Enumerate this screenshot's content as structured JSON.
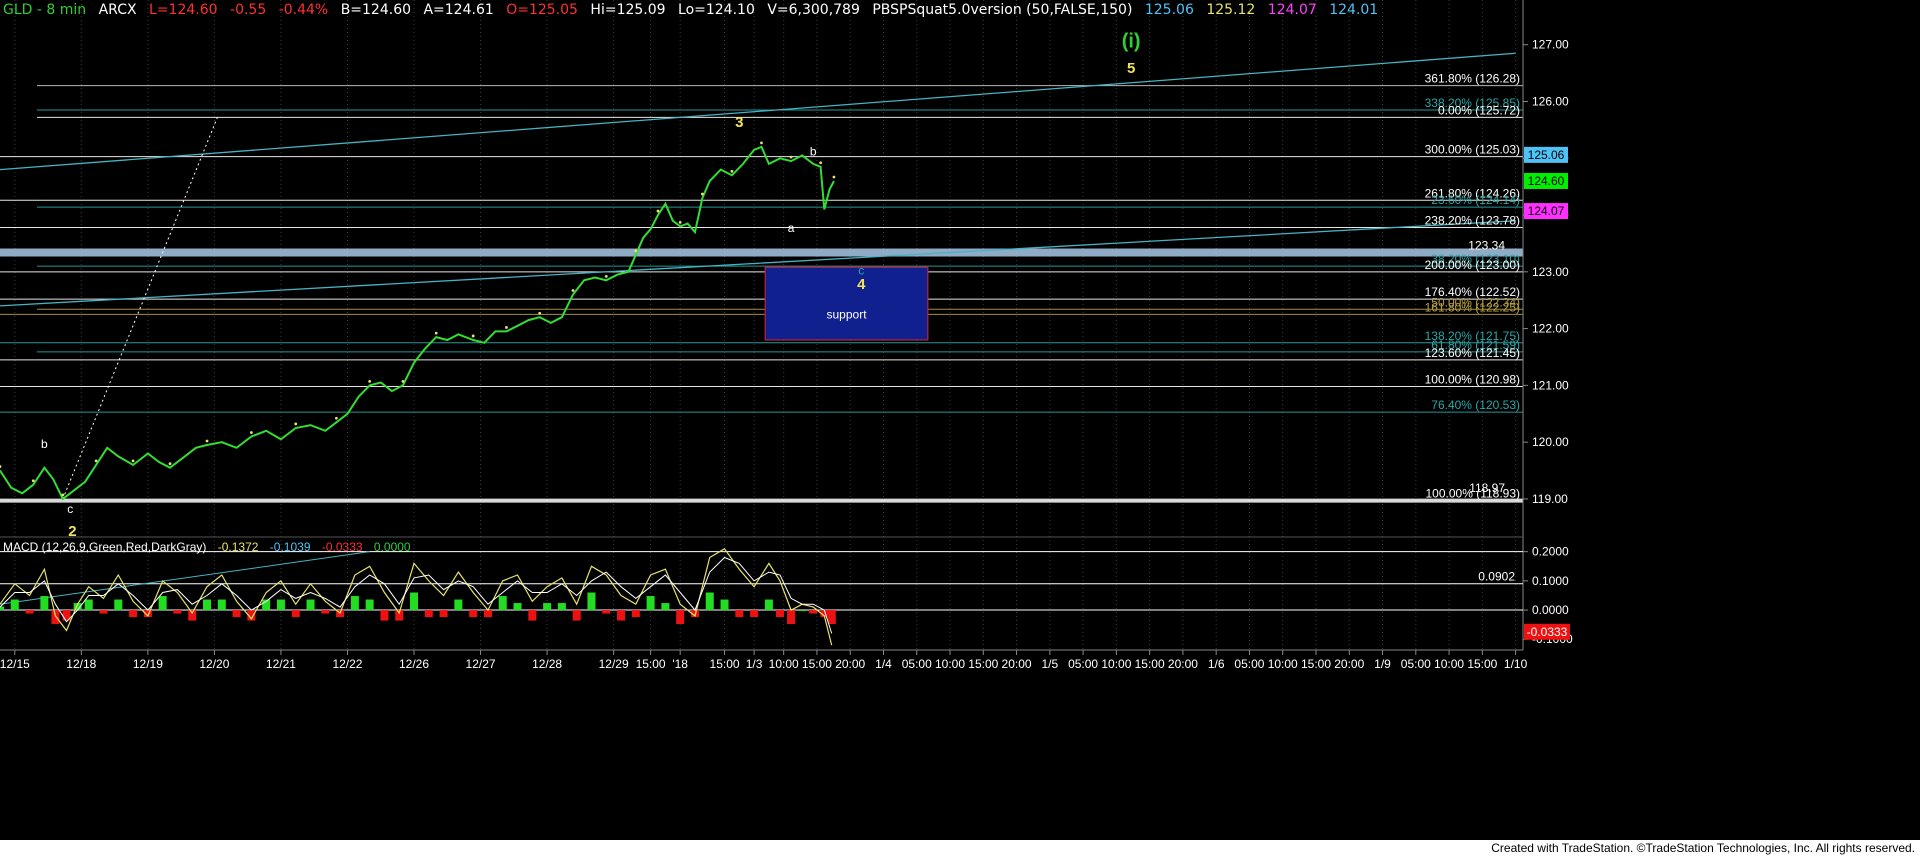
{
  "header": {
    "symbol": "GLD - 8 min",
    "exchange": "ARCX",
    "last": "L=124.60",
    "change": "-0.55",
    "change_pct": "-0.44%",
    "bid": "B=124.60",
    "ask": "A=124.61",
    "open": "O=125.05",
    "high": "Hi=125.09",
    "low": "Lo=124.10",
    "volume": "V=6,300,789",
    "indicator": "PBSPSquat5.0version (50,FALSE,150)",
    "ind_values": [
      {
        "text": "125.06",
        "color": "#4fc3f7"
      },
      {
        "text": "125.12",
        "color": "#e8e26a"
      },
      {
        "text": "124.07",
        "color": "#ff40ff"
      },
      {
        "text": "124.01",
        "color": "#4fc3f7"
      }
    ]
  },
  "macd_header": {
    "name": "MACD (12,26,9,Green,Red,DarkGray)",
    "values": [
      {
        "text": "-0.1372",
        "color": "#e8e26a"
      },
      {
        "text": "-0.1039",
        "color": "#4fc3f7"
      },
      {
        "text": "-0.0333",
        "color": "#ff3030"
      },
      {
        "text": "0.0000",
        "color": "#2ecc40"
      }
    ]
  },
  "footer": "Created with TradeStation. ©TradeStation Technologies, Inc. All rights reserved.",
  "colors": {
    "background": "#000000",
    "price": "#33dd33",
    "fib_white": "#ffffff",
    "fib_teal": "#2aa7a7",
    "fib_olive": "#b8a040",
    "trend": "#45b3c3",
    "support_box": "#10208f",
    "wave_yellow": "#f2e35a",
    "wave_green": "#2fcf2f",
    "macd_pos": "#22dd22",
    "macd_neg": "#ee1111"
  },
  "chart_data": {
    "type": "line",
    "title": "GLD - 8 min",
    "ylim": [
      118.4,
      127.4
    ],
    "price_ticks": [
      "127.00",
      "126.00",
      "125.00",
      "124.00",
      "123.00",
      "122.00",
      "121.00",
      "120.00",
      "119.00"
    ],
    "price_tick_values": [
      127,
      126,
      125,
      124,
      123,
      122,
      121,
      120,
      119
    ],
    "macd_ylim": [
      -0.13,
      0.24
    ],
    "macd_ticks": [
      "0.2000",
      "0.1000",
      "0.0000",
      "-0.1000"
    ],
    "macd_tick_values": [
      0.2,
      0.1,
      0.0,
      -0.1
    ],
    "x_ticks": [
      "12/15",
      "12/18",
      "12/19",
      "12/20",
      "12/21",
      "12/22",
      "12/26",
      "12/27",
      "12/28",
      "12/29",
      "15:00",
      "'18",
      "15:00",
      "1/3",
      "10:00",
      "15:00",
      "20:00",
      "1/4",
      "05:00",
      "10:00",
      "15:00",
      "20:00",
      "1/5",
      "05:00",
      "10:00",
      "15:00",
      "20:00",
      "1/6",
      "05:00",
      "10:00",
      "15:00",
      "20:00",
      "1/9",
      "05:00",
      "10:00",
      "15:00",
      "1/10"
    ],
    "x_tick_pos": [
      0.2,
      1.1,
      2.0,
      2.9,
      3.8,
      4.7,
      5.6,
      6.5,
      7.4,
      8.3,
      8.8,
      9.2,
      9.8,
      10.2,
      10.6,
      11.05,
      11.5,
      11.95,
      12.4,
      12.85,
      13.3,
      13.75,
      14.2,
      14.65,
      15.1,
      15.55,
      16.0,
      16.45,
      16.9,
      17.35,
      17.8,
      18.25,
      18.7,
      19.15,
      19.6,
      20.05,
      20.5
    ],
    "x_range": [
      0,
      20.6
    ],
    "price_series": [
      [
        0.0,
        119.5
      ],
      [
        0.15,
        119.2
      ],
      [
        0.3,
        119.1
      ],
      [
        0.45,
        119.25
      ],
      [
        0.6,
        119.55
      ],
      [
        0.72,
        119.35
      ],
      [
        0.85,
        119.0
      ],
      [
        1.0,
        119.15
      ],
      [
        1.15,
        119.3
      ],
      [
        1.3,
        119.6
      ],
      [
        1.45,
        119.9
      ],
      [
        1.6,
        119.75
      ],
      [
        1.8,
        119.6
      ],
      [
        2.0,
        119.8
      ],
      [
        2.15,
        119.65
      ],
      [
        2.3,
        119.55
      ],
      [
        2.5,
        119.75
      ],
      [
        2.65,
        119.9
      ],
      [
        2.8,
        119.95
      ],
      [
        3.0,
        120.0
      ],
      [
        3.2,
        119.9
      ],
      [
        3.4,
        120.1
      ],
      [
        3.6,
        120.2
      ],
      [
        3.8,
        120.05
      ],
      [
        4.0,
        120.25
      ],
      [
        4.2,
        120.3
      ],
      [
        4.4,
        120.2
      ],
      [
        4.55,
        120.35
      ],
      [
        4.7,
        120.5
      ],
      [
        4.85,
        120.8
      ],
      [
        5.0,
        121.0
      ],
      [
        5.15,
        121.05
      ],
      [
        5.3,
        120.9
      ],
      [
        5.45,
        121.0
      ],
      [
        5.6,
        121.4
      ],
      [
        5.75,
        121.65
      ],
      [
        5.9,
        121.85
      ],
      [
        6.05,
        121.8
      ],
      [
        6.2,
        121.9
      ],
      [
        6.4,
        121.8
      ],
      [
        6.55,
        121.75
      ],
      [
        6.7,
        121.95
      ],
      [
        6.85,
        121.95
      ],
      [
        7.0,
        122.05
      ],
      [
        7.15,
        122.15
      ],
      [
        7.3,
        122.2
      ],
      [
        7.45,
        122.1
      ],
      [
        7.6,
        122.2
      ],
      [
        7.75,
        122.6
      ],
      [
        7.9,
        122.85
      ],
      [
        8.05,
        122.9
      ],
      [
        8.2,
        122.85
      ],
      [
        8.35,
        122.95
      ],
      [
        8.5,
        123.0
      ],
      [
        8.6,
        123.3
      ],
      [
        8.7,
        123.6
      ],
      [
        8.8,
        123.75
      ],
      [
        8.9,
        124.0
      ],
      [
        9.0,
        124.2
      ],
      [
        9.1,
        123.9
      ],
      [
        9.2,
        123.8
      ],
      [
        9.3,
        123.85
      ],
      [
        9.4,
        123.7
      ],
      [
        9.5,
        124.3
      ],
      [
        9.6,
        124.6
      ],
      [
        9.75,
        124.8
      ],
      [
        9.9,
        124.7
      ],
      [
        10.05,
        124.9
      ],
      [
        10.2,
        125.15
      ],
      [
        10.3,
        125.2
      ],
      [
        10.4,
        124.9
      ],
      [
        10.55,
        125.0
      ],
      [
        10.7,
        124.95
      ],
      [
        10.85,
        125.05
      ],
      [
        11.0,
        124.9
      ],
      [
        11.1,
        124.85
      ],
      [
        11.15,
        124.1
      ],
      [
        11.22,
        124.45
      ],
      [
        11.28,
        124.6
      ]
    ],
    "fib_levels": [
      {
        "value": 126.28,
        "label": "361.80% (126.28)",
        "color": "#ffffff",
        "line": "#cccccc",
        "x_start": 0.5
      },
      {
        "value": 125.85,
        "label": "338.20% (125.85)",
        "color": "#2aa7a7",
        "line": "#2aa7a7",
        "x_start": 0.5
      },
      {
        "value": 125.72,
        "label": "0.00% (125.72)",
        "color": "#ffffff",
        "line": "#ffffff",
        "x_start": 0.5
      },
      {
        "value": 125.03,
        "label": "300.00% (125.03)",
        "color": "#ffffff",
        "line": "#ffffff",
        "x_start": 0.0
      },
      {
        "value": 124.26,
        "label": "261.80% (124.26)",
        "color": "#ffffff",
        "line": "#ffffff",
        "x_start": 0.0
      },
      {
        "value": 124.14,
        "label": "23.60% (124.14)",
        "color": "#2aa7a7",
        "line": "#2aa7a7",
        "x_start": 0.5
      },
      {
        "value": 123.78,
        "label": "238.20% (123.78)",
        "color": "#ffffff",
        "line": "#ffffff",
        "x_start": 0.0
      },
      {
        "value": 123.1,
        "label": "38.20% (123.10)",
        "color": "#2aa7a7",
        "line": "#2aa7a7",
        "x_start": 0.5
      },
      {
        "value": 123.0,
        "label": "200.00% (123.00)",
        "color": "#ffffff",
        "line": "#ffffff",
        "x_start": 0.0
      },
      {
        "value": 122.52,
        "label": "176.40% (122.52)",
        "color": "#ffffff",
        "line": "#ffffff",
        "x_start": 0.0
      },
      {
        "value": 122.34,
        "label": "50.00% (122.34)",
        "color": "#b8a040",
        "line": "#b8a040",
        "x_start": 0.5
      },
      {
        "value": 122.25,
        "label": "161.80% (122.25)",
        "color": "#b8a040",
        "line": "#b8a040",
        "x_start": 0.0
      },
      {
        "value": 121.75,
        "label": "138.20% (121.75)",
        "color": "#2aa7a7",
        "line": "#2aa7a7",
        "x_start": 0.0
      },
      {
        "value": 121.59,
        "label": "61.80% (121.59)",
        "color": "#2aa7a7",
        "line": "#2aa7a7",
        "x_start": 0.5
      },
      {
        "value": 121.45,
        "label": "123.60% (121.45)",
        "color": "#ffffff",
        "line": "#ffffff",
        "x_start": 0.0
      },
      {
        "value": 120.98,
        "label": "100.00% (120.98)",
        "color": "#ffffff",
        "line": "#ffffff",
        "x_start": 0.0
      },
      {
        "value": 120.53,
        "label": "76.40% (120.53)",
        "color": "#2aa7a7",
        "line": "#2aa7a7",
        "x_start": 0.0
      },
      {
        "value": 118.97,
        "label": "100.00% (118.93)",
        "color": "#ffffff",
        "line": "#ffffff",
        "x_start": 0.0
      }
    ],
    "extra_right_labels": [
      {
        "value": 123.34,
        "text": "123.34",
        "color": "#ffffff"
      },
      {
        "value": 119.07,
        "text": "118.97",
        "color": "#ffffff"
      }
    ],
    "price_badges": [
      {
        "value": 125.06,
        "text": "125.06",
        "bg": "#4fc3f7",
        "fg": "#000000"
      },
      {
        "value": 124.6,
        "text": "124.60",
        "bg": "#00ee00",
        "fg": "#000000"
      },
      {
        "value": 124.07,
        "text": "124.07",
        "bg": "#ff30ff",
        "fg": "#000000"
      }
    ],
    "blue_band": {
      "value": 123.34
    },
    "support_box": {
      "x0": 10.35,
      "x1": 12.55,
      "y0": 121.8,
      "y1": 123.08,
      "label": "support"
    },
    "trendlines": [
      {
        "x0": 0.0,
        "y0": 124.8,
        "x1": 20.5,
        "y1": 126.85
      },
      {
        "x0": 0.0,
        "y0": 122.4,
        "x1": 20.5,
        "y1": 123.9
      }
    ],
    "dotted_line": {
      "x0": 0.85,
      "y0": 119.0,
      "x1": 2.95,
      "y1": 125.75
    },
    "wave_labels": [
      {
        "x": 0.6,
        "y": 119.9,
        "text": "b",
        "color": "#ffffff",
        "size": 12
      },
      {
        "x": 0.95,
        "y": 118.75,
        "text": "c",
        "color": "#ffffff",
        "size": 12
      },
      {
        "x": 0.98,
        "y": 118.35,
        "text": "2",
        "color": "#f2e35a",
        "size": 15
      },
      {
        "x": 10.0,
        "y": 125.55,
        "text": "3",
        "color": "#f2e35a",
        "size": 15
      },
      {
        "x": 11.0,
        "y": 125.05,
        "text": "b",
        "color": "#ffffff",
        "size": 12
      },
      {
        "x": 10.7,
        "y": 123.7,
        "text": "a",
        "color": "#ffffff",
        "size": 12
      },
      {
        "x": 11.65,
        "y": 122.95,
        "text": "c",
        "color": "#2aa7a7",
        "size": 12
      },
      {
        "x": 11.65,
        "y": 122.7,
        "text": "4",
        "color": "#f2e35a",
        "size": 15
      },
      {
        "x": 15.3,
        "y": 126.5,
        "text": "5",
        "color": "#f2e35a",
        "size": 15
      },
      {
        "x": 15.3,
        "y": 126.95,
        "text": "(i)",
        "color": "#2fcf2f",
        "size": 20
      }
    ],
    "macd_level_lines": [
      {
        "value": 0.2,
        "label": ""
      },
      {
        "value": 0.0902,
        "label": "0.0902"
      },
      {
        "value": 0.0,
        "label": ""
      }
    ],
    "macd_badges": [
      {
        "value": -0.0333,
        "text": "-0.0333",
        "bg": "#ee1111",
        "fg": "#ffffff"
      }
    ],
    "macd_series": [
      [
        0.0,
        0.02
      ],
      [
        0.2,
        0.09
      ],
      [
        0.4,
        0.05
      ],
      [
        0.6,
        0.14
      ],
      [
        0.75,
        -0.02
      ],
      [
        0.9,
        -0.07
      ],
      [
        1.05,
        0.02
      ],
      [
        1.2,
        0.08
      ],
      [
        1.4,
        0.04
      ],
      [
        1.6,
        0.12
      ],
      [
        1.8,
        0.03
      ],
      [
        2.0,
        -0.02
      ],
      [
        2.2,
        0.1
      ],
      [
        2.4,
        0.06
      ],
      [
        2.6,
        -0.01
      ],
      [
        2.8,
        0.08
      ],
      [
        3.0,
        0.12
      ],
      [
        3.2,
        0.03
      ],
      [
        3.4,
        -0.03
      ],
      [
        3.6,
        0.06
      ],
      [
        3.8,
        0.1
      ],
      [
        4.0,
        0.02
      ],
      [
        4.2,
        0.09
      ],
      [
        4.4,
        0.03
      ],
      [
        4.6,
        -0.01
      ],
      [
        4.8,
        0.12
      ],
      [
        5.0,
        0.15
      ],
      [
        5.2,
        0.06
      ],
      [
        5.4,
        -0.01
      ],
      [
        5.6,
        0.16
      ],
      [
        5.8,
        0.1
      ],
      [
        6.0,
        0.05
      ],
      [
        6.2,
        0.13
      ],
      [
        6.4,
        0.06
      ],
      [
        6.6,
        0.0
      ],
      [
        6.8,
        0.1
      ],
      [
        7.0,
        0.12
      ],
      [
        7.2,
        0.03
      ],
      [
        7.4,
        0.08
      ],
      [
        7.6,
        0.11
      ],
      [
        7.8,
        0.02
      ],
      [
        8.0,
        0.15
      ],
      [
        8.2,
        0.12
      ],
      [
        8.4,
        0.05
      ],
      [
        8.6,
        0.02
      ],
      [
        8.8,
        0.12
      ],
      [
        9.0,
        0.14
      ],
      [
        9.2,
        0.02
      ],
      [
        9.4,
        -0.02
      ],
      [
        9.6,
        0.18
      ],
      [
        9.8,
        0.21
      ],
      [
        10.0,
        0.14
      ],
      [
        10.2,
        0.08
      ],
      [
        10.4,
        0.16
      ],
      [
        10.55,
        0.1
      ],
      [
        10.7,
        0.0
      ],
      [
        10.85,
        0.02
      ],
      [
        11.0,
        0.01
      ],
      [
        11.15,
        -0.02
      ],
      [
        11.25,
        -0.12
      ]
    ],
    "macd_signal": [
      [
        0.0,
        0.01
      ],
      [
        0.2,
        0.06
      ],
      [
        0.4,
        0.06
      ],
      [
        0.6,
        0.1
      ],
      [
        0.75,
        0.02
      ],
      [
        0.9,
        -0.04
      ],
      [
        1.05,
        0.0
      ],
      [
        1.2,
        0.05
      ],
      [
        1.4,
        0.05
      ],
      [
        1.6,
        0.09
      ],
      [
        1.8,
        0.05
      ],
      [
        2.0,
        0.0
      ],
      [
        2.2,
        0.06
      ],
      [
        2.4,
        0.07
      ],
      [
        2.6,
        0.02
      ],
      [
        2.8,
        0.05
      ],
      [
        3.0,
        0.09
      ],
      [
        3.2,
        0.05
      ],
      [
        3.4,
        0.0
      ],
      [
        3.6,
        0.03
      ],
      [
        3.8,
        0.07
      ],
      [
        4.0,
        0.04
      ],
      [
        4.2,
        0.06
      ],
      [
        4.4,
        0.04
      ],
      [
        4.6,
        0.01
      ],
      [
        4.8,
        0.08
      ],
      [
        5.0,
        0.12
      ],
      [
        5.2,
        0.09
      ],
      [
        5.4,
        0.02
      ],
      [
        5.6,
        0.11
      ],
      [
        5.8,
        0.12
      ],
      [
        6.0,
        0.07
      ],
      [
        6.2,
        0.1
      ],
      [
        6.4,
        0.08
      ],
      [
        6.6,
        0.02
      ],
      [
        6.8,
        0.06
      ],
      [
        7.0,
        0.1
      ],
      [
        7.2,
        0.06
      ],
      [
        7.4,
        0.06
      ],
      [
        7.6,
        0.09
      ],
      [
        7.8,
        0.05
      ],
      [
        8.0,
        0.1
      ],
      [
        8.2,
        0.13
      ],
      [
        8.4,
        0.08
      ],
      [
        8.6,
        0.04
      ],
      [
        8.8,
        0.08
      ],
      [
        9.0,
        0.12
      ],
      [
        9.2,
        0.06
      ],
      [
        9.4,
        0.0
      ],
      [
        9.6,
        0.13
      ],
      [
        9.8,
        0.18
      ],
      [
        10.0,
        0.16
      ],
      [
        10.2,
        0.1
      ],
      [
        10.4,
        0.13
      ],
      [
        10.55,
        0.12
      ],
      [
        10.7,
        0.04
      ],
      [
        10.85,
        0.02
      ],
      [
        11.0,
        0.02
      ],
      [
        11.15,
        0.0
      ],
      [
        11.25,
        -0.08
      ]
    ]
  }
}
